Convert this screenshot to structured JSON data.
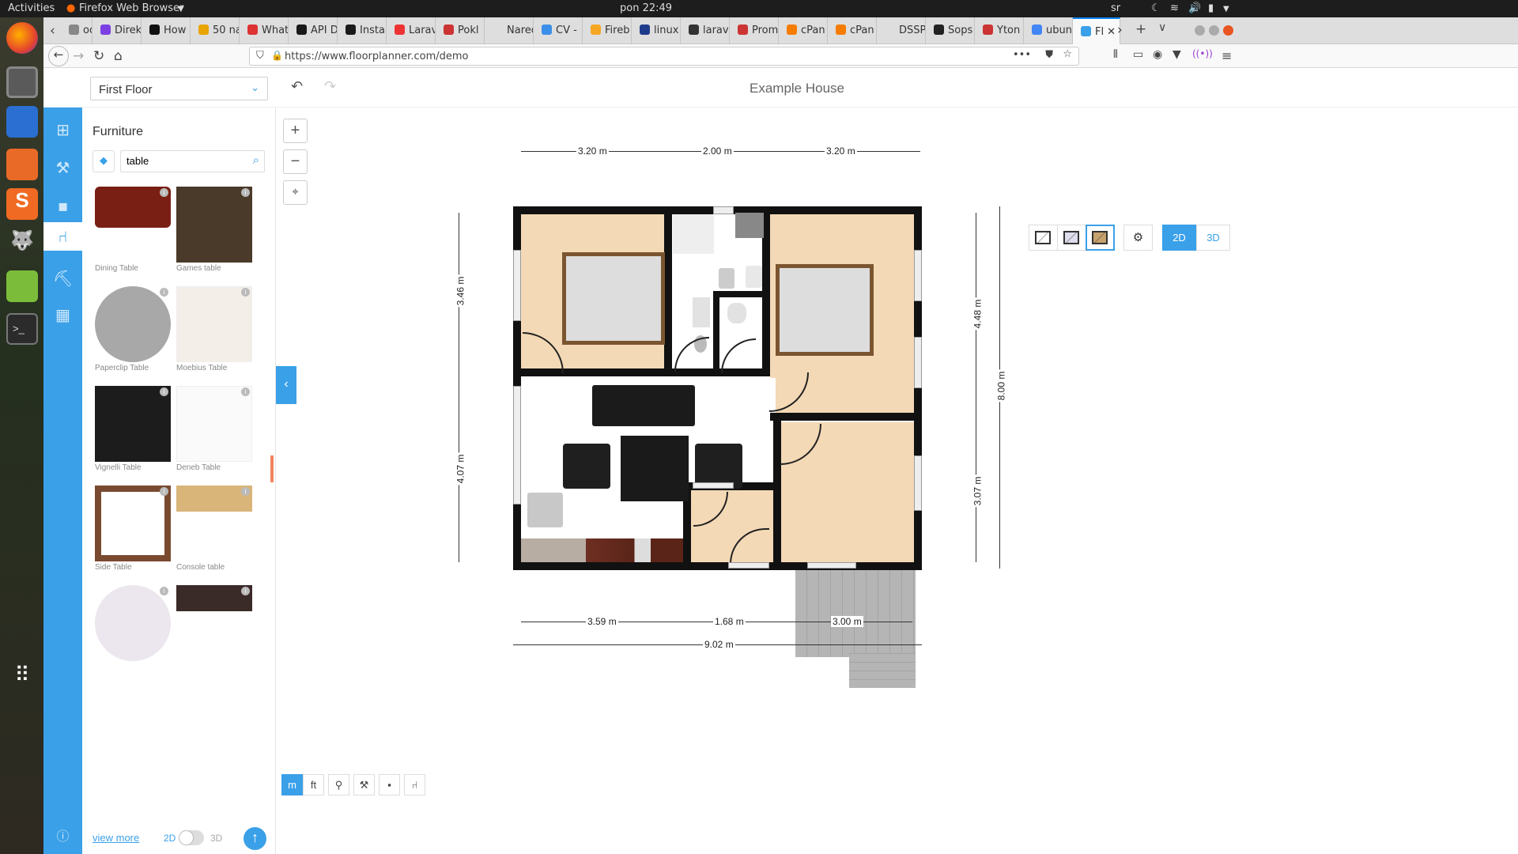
{
  "system": {
    "activities": "Activities",
    "app_menu": "Firefox Web Browser",
    "clock": "pon 22:49",
    "tray_lang": "sr"
  },
  "browser": {
    "tabs": [
      {
        "label": "oog",
        "color": "#888"
      },
      {
        "label": "Direk",
        "color": "#7b3fe4"
      },
      {
        "label": "How",
        "color": "#111"
      },
      {
        "label": "50 na",
        "color": "#e8a400"
      },
      {
        "label": "What",
        "color": "#d33"
      },
      {
        "label": "API D",
        "color": "#1a1a1a"
      },
      {
        "label": "Insta",
        "color": "#1a1a1a"
      },
      {
        "label": "Larav",
        "color": "#e33"
      },
      {
        "label": "Pokl",
        "color": "#c33"
      },
      {
        "label": "Naredbe",
        "color": "#dedede"
      },
      {
        "label": "CV -",
        "color": "#3b8fe8"
      },
      {
        "label": "Fireb",
        "color": "#f5a623"
      },
      {
        "label": "linux",
        "color": "#1e3a8a"
      },
      {
        "label": "larav",
        "color": "#333"
      },
      {
        "label": "Prom",
        "color": "#c33"
      },
      {
        "label": "cPan",
        "color": "#f57c00"
      },
      {
        "label": "cPan",
        "color": "#f57c00"
      },
      {
        "label": "DSSP Z",
        "color": "#dedede"
      },
      {
        "label": "Sops",
        "color": "#222"
      },
      {
        "label": "Yton",
        "color": "#c33"
      },
      {
        "label": "ubun",
        "color": "#4285f4"
      },
      {
        "label": "Fl",
        "color": "#3aa0e8",
        "active": true
      }
    ],
    "url": "https://www.floorplanner.com/demo"
  },
  "header": {
    "floor": "First Floor",
    "title": "Example House"
  },
  "panel": {
    "heading": "Furniture",
    "search_value": "table",
    "items": [
      {
        "name": "Dining Table",
        "color": "#7a1f14"
      },
      {
        "name": "Games table",
        "color": "#4a3a2a"
      },
      {
        "name": "Paperclip Table",
        "color": "#a8a8a8"
      },
      {
        "name": "Moebius Table",
        "color": "#f3eee8"
      },
      {
        "name": "Vignelli Table",
        "color": "#1c1c1c"
      },
      {
        "name": "Deneb Table",
        "color": "#fafafa"
      },
      {
        "name": "Side Table",
        "color": "#7a4a30"
      },
      {
        "name": "Console table",
        "color": "#d9b57a"
      },
      {
        "name": "",
        "color": "#ece6ee"
      },
      {
        "name": "",
        "color": "#3a2a28"
      }
    ],
    "view_more": "view more",
    "toggle_2d": "2D",
    "toggle_3d": "3D"
  },
  "canvas": {
    "view_2d": "2D",
    "view_3d": "3D",
    "units": [
      "m",
      "ft"
    ],
    "dims": {
      "top_a": "3.20 m",
      "top_b": "2.00 m",
      "top_c": "3.20 m",
      "left_a": "3.46 m",
      "left_b": "4.07 m",
      "right_a": "4.48 m",
      "right_b": "3.07 m",
      "right_total": "8.00 m",
      "bot_a": "3.59 m",
      "bot_b": "1.68 m",
      "bot_c": "3.00 m",
      "bot_total": "9.02 m"
    }
  }
}
